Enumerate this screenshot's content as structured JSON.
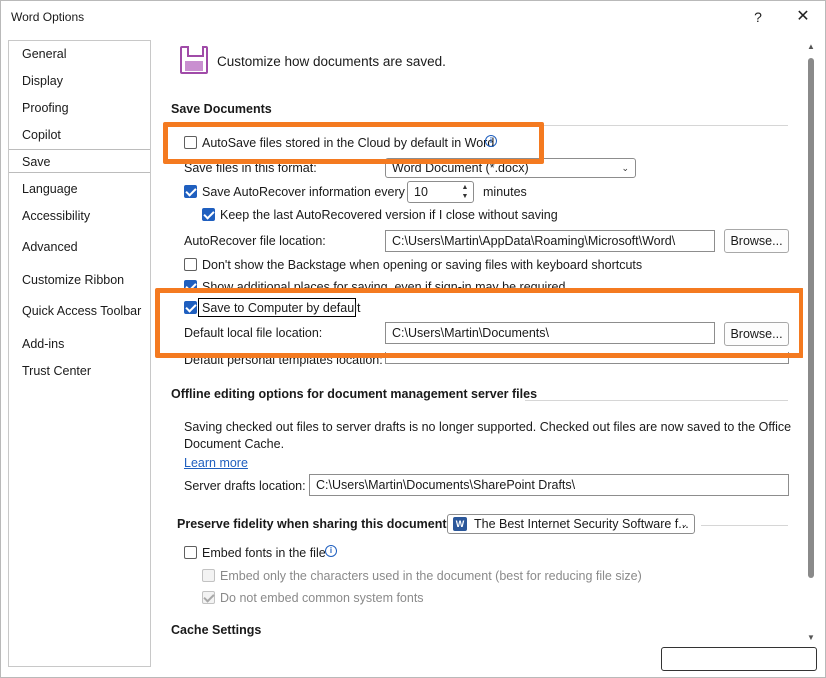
{
  "window": {
    "title": "Word Options",
    "help_glyph": "?",
    "close_glyph": "✕"
  },
  "sidebar": {
    "items": [
      {
        "label": "General"
      },
      {
        "label": "Display"
      },
      {
        "label": "Proofing"
      },
      {
        "label": "Copilot"
      },
      {
        "label": "Save",
        "selected": true
      },
      {
        "label": "Language"
      },
      {
        "label": "Accessibility"
      },
      {
        "label": "Advanced"
      },
      {
        "label": "Customize Ribbon"
      },
      {
        "label": "Quick Access Toolbar"
      },
      {
        "label": "Add-ins"
      },
      {
        "label": "Trust Center"
      }
    ]
  },
  "header": {
    "text": "Customize how documents are saved.",
    "icon": "save-floppy-icon"
  },
  "save_documents": {
    "title": "Save Documents",
    "autosave_label": "AutoSave files stored in the Cloud by default in Word",
    "format_label": "Save files in this format:",
    "format_value": "Word Document (*.docx)",
    "autorecover_label": "Save AutoRecover information every",
    "autorecover_value": "10",
    "minutes_label": "minutes",
    "keep_last_label": "Keep the last AutoRecovered version if I close without saving",
    "autorecover_location_label": "AutoRecover file location:",
    "autorecover_location_value": "C:\\Users\\Martin\\AppData\\Roaming\\Microsoft\\Word\\",
    "browse_label": "Browse...",
    "backstage_label": "Don't show the Backstage when opening or saving files with keyboard shortcuts",
    "additional_places_label": "Show additional places for saving, even if sign-in may be required.",
    "save_to_computer_label": "Save to Computer by default",
    "default_local_label": "Default local file location:",
    "default_local_value": "C:\\Users\\Martin\\Documents\\",
    "personal_templates_label": "Default personal templates location:"
  },
  "offline": {
    "title": "Offline editing options for document management server files",
    "notice_line1": "Saving checked out files to server drafts is no longer supported. Checked out files are now saved to the Office",
    "notice_line2": "Document Cache.",
    "learn_more": "Learn more",
    "drafts_label": "Server drafts location:",
    "drafts_value": "C:\\Users\\Martin\\Documents\\SharePoint Drafts\\"
  },
  "fidelity": {
    "title": "Preserve fidelity when sharing this document:",
    "document_value": "The Best Internet Security Software f...",
    "embed_fonts_label": "Embed fonts in the file",
    "embed_only_label": "Embed only the characters used in the document (best for reducing file size)",
    "do_not_embed_label": "Do not embed common system fonts"
  },
  "cache": {
    "title": "Cache Settings"
  },
  "colors": {
    "accent": "#1f5fbf",
    "highlight": "#f47a20",
    "icon": "#a04ba8"
  }
}
